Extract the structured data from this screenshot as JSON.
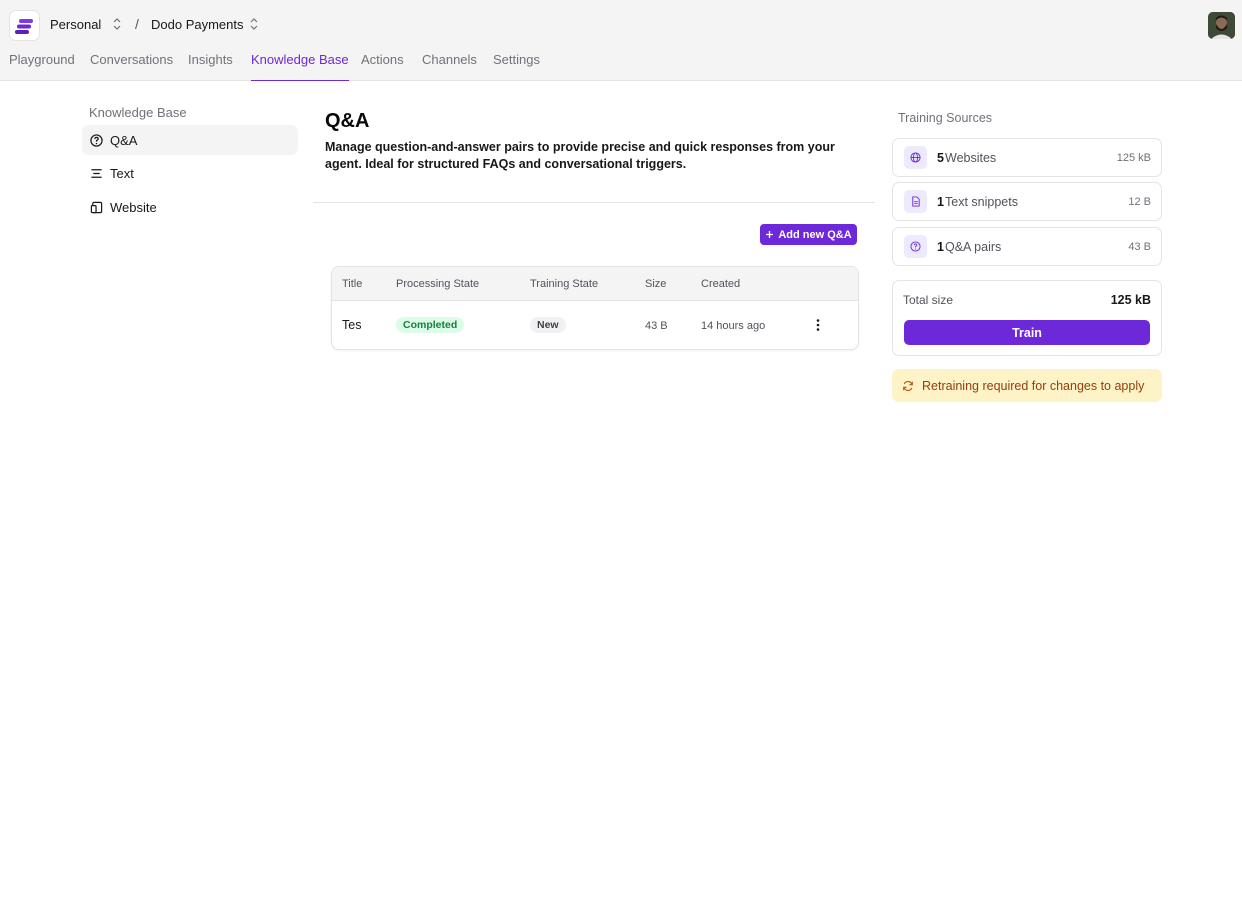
{
  "header": {
    "workspace": "Personal",
    "separator": "/",
    "project": "Dodo Payments"
  },
  "tabs": [
    {
      "label": "Playground"
    },
    {
      "label": "Conversations"
    },
    {
      "label": "Insights"
    },
    {
      "label": "Knowledge Base",
      "active": true
    },
    {
      "label": "Actions"
    },
    {
      "label": "Channels"
    },
    {
      "label": "Settings"
    }
  ],
  "sidebar": {
    "heading": "Knowledge Base",
    "items": [
      {
        "label": "Q&A",
        "icon": "question-circle-icon",
        "active": true
      },
      {
        "label": "Text",
        "icon": "text-align-icon"
      },
      {
        "label": "Website",
        "icon": "website-icon"
      }
    ]
  },
  "main": {
    "title": "Q&A",
    "description": "Manage question-and-answer pairs to provide precise and quick responses from your agent. Ideal for structured FAQs and conversational triggers.",
    "add_button": "Add new Q&A",
    "table": {
      "columns": [
        "Title",
        "Processing State",
        "Training State",
        "Size",
        "Created"
      ],
      "rows": [
        {
          "title": "Tes",
          "processing": "Completed",
          "training": "New",
          "size": "43 B",
          "created": "14 hours ago"
        }
      ]
    }
  },
  "training_sources": {
    "heading": "Training Sources",
    "sources": [
      {
        "count": "5",
        "label": "Websites",
        "size": "125 kB",
        "icon": "globe-icon"
      },
      {
        "count": "1",
        "label": "Text snippets",
        "size": "12 B",
        "icon": "document-icon"
      },
      {
        "count": "1",
        "label": "Q&A pairs",
        "size": "43 B",
        "icon": "question-circle-icon"
      }
    ],
    "total_label": "Total size",
    "total_value": "125 kB",
    "train_button": "Train",
    "warning": "Retraining required for changes to apply"
  },
  "colors": {
    "accent": "#6d28d9",
    "success_bg": "#dcfce7",
    "success_text": "#15803d",
    "warning_bg": "#fef3c7",
    "warning_text": "#92400e"
  }
}
